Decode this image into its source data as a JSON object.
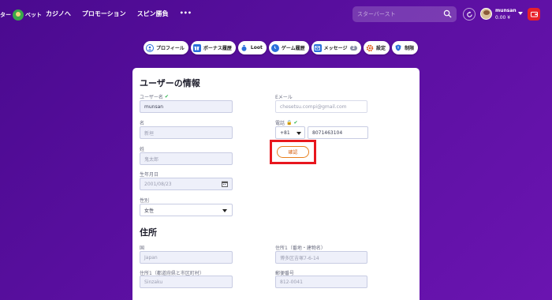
{
  "brand": {
    "logo_text_left": "ター",
    "logo_text_right": "ベット"
  },
  "nav": {
    "links": [
      "カジノへ",
      "プロモーション",
      "スピン勝負",
      "•••"
    ]
  },
  "search": {
    "placeholder": "スターバースト"
  },
  "user": {
    "name": "munsan",
    "balance": "0.00 ¥"
  },
  "tabs": [
    {
      "label": "プロフィール",
      "icon": "user-circle-icon",
      "color": "#2a6fdb"
    },
    {
      "label": "ボーナス履歴",
      "icon": "gift-icon",
      "color": "#2a6fdb"
    },
    {
      "label": "Loot",
      "icon": "money-bag-icon",
      "color": "#2a6fdb"
    },
    {
      "label": "ゲーム履歴",
      "icon": "clock-icon",
      "color": "#2a6fdb"
    },
    {
      "label": "メッセージ",
      "icon": "mail-icon",
      "color": "#2a6fdb",
      "badge": "2"
    },
    {
      "label": "設定",
      "icon": "gear-icon",
      "color": "#e05a1a"
    },
    {
      "label": "制限",
      "icon": "shield-icon",
      "color": "#2a6fdb"
    }
  ],
  "profile": {
    "title": "ユーザーの情報",
    "username_label": "ユーザー名",
    "username_value": "munsan",
    "email_label": "Eメール",
    "email_value": "chesetsu.compi@gmail.com",
    "lastname_label": "名",
    "lastname_value": "新垣",
    "phone_label": "電話",
    "phone_code": "+81",
    "phone_number": "8071463104",
    "firstname_label": "姓",
    "firstname_value": "鬼太郎",
    "confirm_label": "確認",
    "dob_label": "生年月日",
    "dob_value": "2001/08/23",
    "gender_label": "性別",
    "gender_value": "女性"
  },
  "address": {
    "title": "住所",
    "country_label": "国",
    "country_value": "Japan",
    "address1_label": "住所1（番地・建物名）",
    "address1_value": "博多区吉塚7-6-14",
    "address2_label": "住所1（都道府県と市区町村）",
    "address2_value": "Sinzaku",
    "postal_label": "郵便番号",
    "postal_value": "812-0041"
  },
  "colors": {
    "accent_red": "#e8171e",
    "confirm_orange": "#d8671a",
    "check_green": "#2bb24c"
  }
}
